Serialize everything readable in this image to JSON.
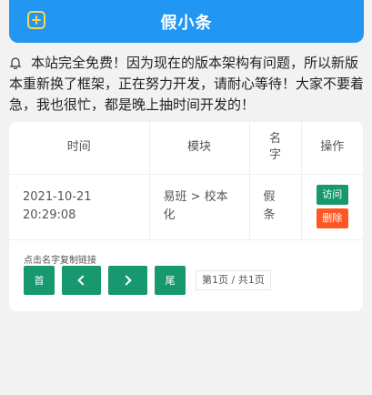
{
  "header": {
    "title": "假小条",
    "add_icon": "plus-square-icon"
  },
  "notice": {
    "icon": "bell-icon",
    "text": "本站完全免费！因为现在的版本架构有问题，所以新版本重新换了框架，正在努力开发，请耐心等待！大家不要着急，我也很忙，都是晚上抽时间开发的！"
  },
  "table": {
    "headers": {
      "time": "时间",
      "module": "模块",
      "name_line1": "名",
      "name_line2": "字",
      "op": "操作"
    },
    "rows": [
      {
        "time_line1": "2021-10-21",
        "time_line2": "20:29:08",
        "module_line1": "易班 > 校本",
        "module_line2": "化",
        "name_line1": "假",
        "name_line2": "条",
        "visit_label": "访问",
        "delete_label": "删除"
      }
    ]
  },
  "pager": {
    "hint": "点击名字复制链接",
    "first_label": "首",
    "last_label": "尾",
    "page_info": "第1页 / 共1页"
  },
  "colors": {
    "header": "#2196f3",
    "accent": "#17986f",
    "danger": "#ff5722",
    "icon": "#ffd54f"
  }
}
